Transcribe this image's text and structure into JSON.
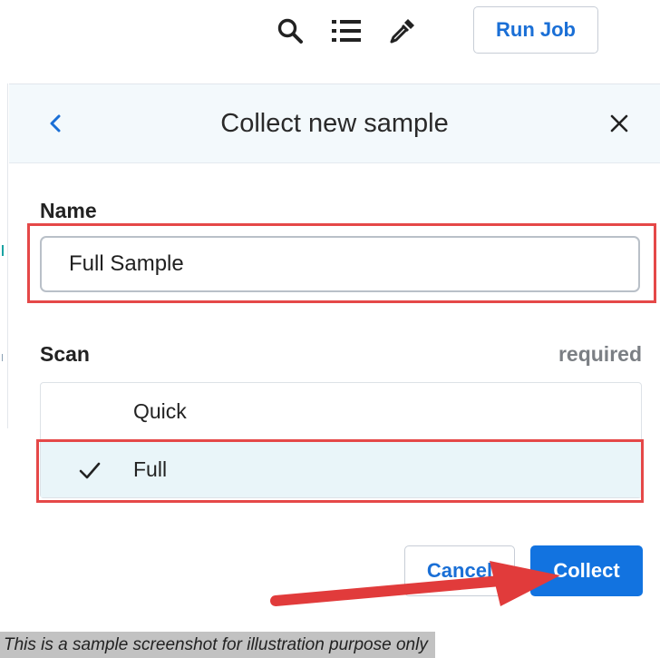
{
  "toolbar": {
    "icons": [
      "search-icon",
      "list-icon",
      "eyedropper-icon"
    ],
    "run_job_label": "Run Job"
  },
  "dialog": {
    "title": "Collect new sample",
    "name": {
      "label": "Name",
      "value": "Full Sample"
    },
    "scan": {
      "label": "Scan",
      "required_text": "required",
      "options": [
        {
          "label": "Quick",
          "selected": false
        },
        {
          "label": "Full",
          "selected": true
        }
      ]
    },
    "cancel_label": "Cancel",
    "collect_label": "Collect"
  },
  "caption": "This is a sample screenshot for illustration purpose only",
  "colors": {
    "accent": "#1273e0",
    "link": "#1a6fd6",
    "highlight": "#e54848",
    "selected_row": "#e9f5f9",
    "header_bg": "#f3f9fc"
  }
}
